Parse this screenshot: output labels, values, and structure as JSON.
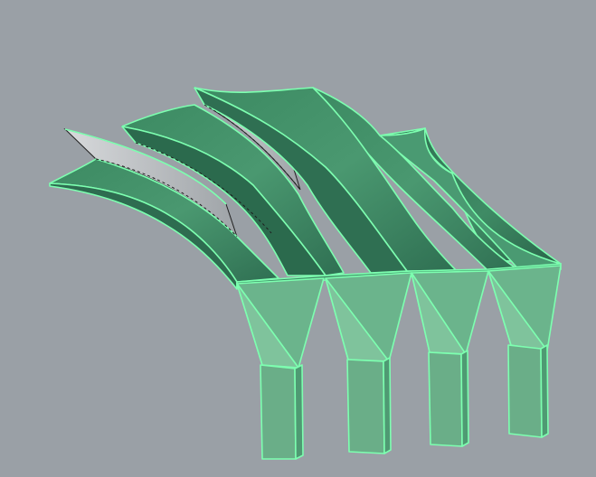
{
  "viewport": {
    "background": "#9aa0a6",
    "shaded_display": true,
    "selection_highlighted": true
  },
  "model": {
    "object": "curved-shell-canopy",
    "shell_strip_count": 5,
    "column_count": 4,
    "colors": {
      "surface_dark": "#2f6f52",
      "surface_mid": "#3d8763",
      "surface_light": "#5aa37c",
      "column_face": "#6bb48c",
      "column_face_light": "#7fc39c",
      "column_side": "#4f9a73",
      "selection_edge": "#7dffb0",
      "back_face": "#c0c4c8"
    }
  }
}
